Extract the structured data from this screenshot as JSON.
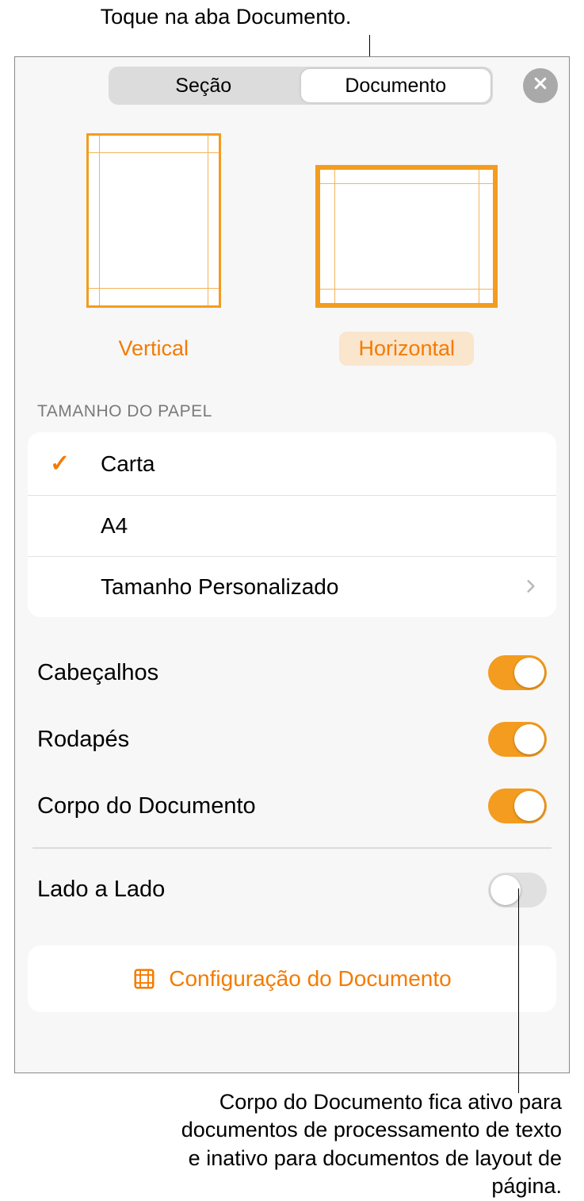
{
  "callout_top": "Toque na aba Documento.",
  "tabs": {
    "section": "Seção",
    "document": "Documento"
  },
  "orientation": {
    "vertical": "Vertical",
    "horizontal": "Horizontal",
    "selected": "horizontal"
  },
  "paper_size": {
    "header": "TAMANHO DO PAPEL",
    "options": {
      "letter": "Carta",
      "a4": "A4",
      "custom": "Tamanho Personalizado"
    },
    "selected": "letter"
  },
  "toggles": {
    "headers": {
      "label": "Cabeçalhos",
      "on": true
    },
    "footers": {
      "label": "Rodapés",
      "on": true
    },
    "body": {
      "label": "Corpo do Documento",
      "on": true
    },
    "facing": {
      "label": "Lado a Lado",
      "on": false
    }
  },
  "config_button": "Configuração do Documento",
  "callout_bottom": "Corpo do Documento fica ativo para documentos de processamento de texto e inativo para documentos de layout de página."
}
